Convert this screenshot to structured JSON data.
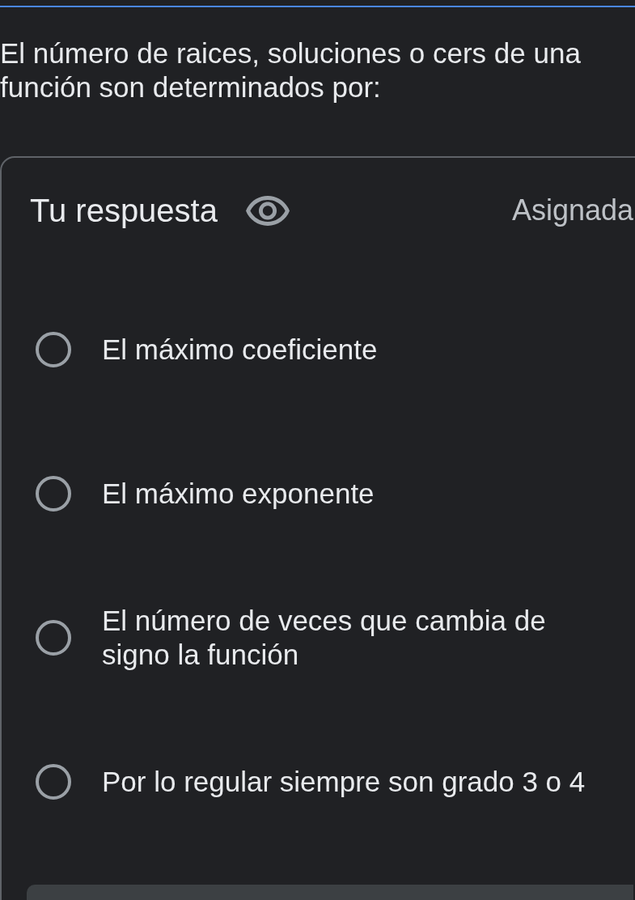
{
  "question": {
    "text": "El número de raices, soluciones o cers de una función son determinados por:"
  },
  "answer": {
    "title": "Tu respuesta",
    "status": "Asignada"
  },
  "options": [
    {
      "label": "El máximo coeficiente",
      "selected": false
    },
    {
      "label": "El máximo exponente",
      "selected": false
    },
    {
      "label": "El número de veces que cambia de signo la función",
      "selected": false
    },
    {
      "label": "Por lo regular siempre son grado 3 o 4",
      "selected": false
    }
  ]
}
